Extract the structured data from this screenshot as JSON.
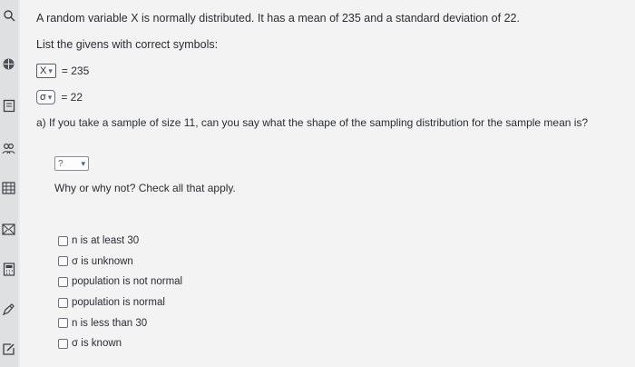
{
  "sidebar": {
    "icons": [
      "search-icon",
      "book-icon",
      "calendar-icon",
      "people-icon",
      "grid-icon",
      "mail-icon",
      "calculator-icon",
      "pencil-icon",
      "edit-icon"
    ]
  },
  "problem": {
    "prompt": "A random variable X is normally distributed. It has a mean of 235 and a standard deviation of 22.",
    "givens_label": "List the givens with correct symbols:",
    "givens": [
      {
        "symbol": "X",
        "value": "= 235"
      },
      {
        "symbol": "σ",
        "value": "= 22"
      }
    ]
  },
  "part_a": {
    "question": "a) If you take a sample of size 11, can you say what the shape of the sampling distribution for the sample mean is?",
    "answer_value": "?",
    "why_label": "Why or why not? Check all that apply.",
    "choices": [
      "n is at least 30",
      "σ is unknown",
      "population is not normal",
      "population is normal",
      "n is less than 30",
      "σ is known"
    ]
  },
  "colors": {
    "accent": "#3b4f8a",
    "background": "#f3f3f4",
    "rail": "#dfe0e2"
  }
}
